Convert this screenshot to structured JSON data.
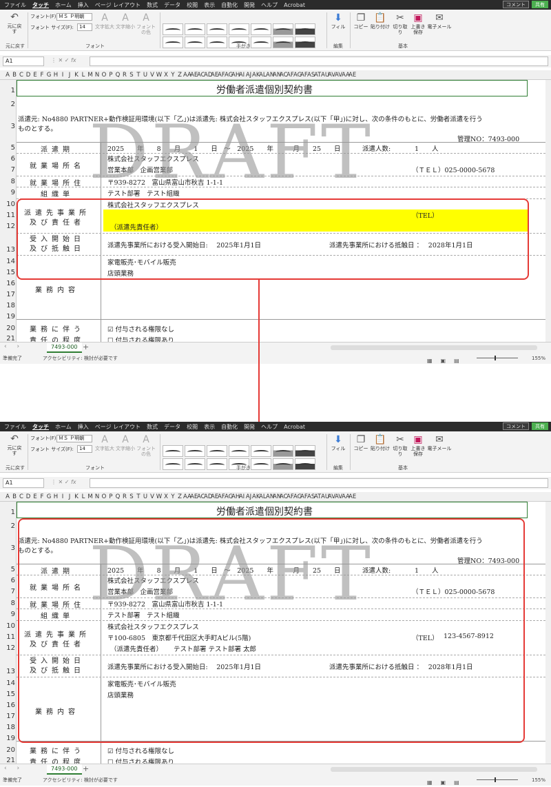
{
  "menu": {
    "items": [
      "ファイル",
      "タッチ",
      "ホーム",
      "挿入",
      "ページ レイアウト",
      "数式",
      "データ",
      "校閲",
      "表示",
      "自動化",
      "開発",
      "ヘルプ",
      "Acrobat"
    ],
    "active_index": 1,
    "comment": "コメント",
    "share": "共有"
  },
  "ribbon": {
    "undo": "元に戻す",
    "undo_group": "元に戻す",
    "font_label": "フォント(F):",
    "font_value": "ＭＳ Ｐ明朝",
    "size_label": "フォント サイズ(F):",
    "size_value": "14",
    "grow": "文字拡大",
    "shrink": "文字縮小",
    "font_color": "フォントの色",
    "font_group": "フォント",
    "ink_group": "手がき",
    "fill": "フィル",
    "edit_group": "編集",
    "copy": "コピー",
    "paste": "貼り付け",
    "cut": "切り取り",
    "save": "上書き保存",
    "email": "電子メール",
    "basic_group": "基本"
  },
  "formula": {
    "name_box": "A1",
    "fx": "fx"
  },
  "columns": [
    "A",
    "B",
    "C",
    "D",
    "E",
    "F",
    "G",
    "H",
    "I",
    "J",
    "K",
    "L",
    "M",
    "N",
    "O",
    "P",
    "Q",
    "R",
    "S",
    "T",
    "U",
    "V",
    "W",
    "X",
    "Y",
    "Z",
    "AA",
    "AE",
    "AC",
    "AD",
    "AE",
    "AF",
    "AG",
    "AH",
    "AI",
    "AJ",
    "AK",
    "AL",
    "AN",
    "AN",
    "AC",
    "AF",
    "AG",
    "AF",
    "AS",
    "AT",
    "AU",
    "AV",
    "AV",
    "AA",
    "AE"
  ],
  "sheet": {
    "title": "労働者派遣個別契約書",
    "intro1": "派遣元: No4880 PARTNER+動作検証用環境(以下「乙」)は派遣先: 株式会社スタッフエクスプレス(以下「甲」)に対し、次の条件のもとに、労働者派遣を行う",
    "intro2": "ものとする。",
    "mgmt_no": "管理NO：7493-000",
    "period_label": "派遣期",
    "period_value": "2025　　年　　8　　月　　1　　日　～　2025　　年　　　月　　25　　日",
    "headcount_label": "派遣人数:",
    "headcount_value": "1　　人",
    "workplace_label": "就業場所名",
    "workplace1": "株式会社スタッフエクスプレス",
    "workplace2": "営業本部　企画営業部",
    "workplace_tel": "（ＴＥＬ）025-0000-5678",
    "address_label": "就業場所住",
    "address_value": "〒939-8272　富山県富山市秋吉 1-1-1",
    "org_label": "組織単",
    "org_value": "テスト部署　テスト組織",
    "dispatch_label1": "派遣先事業所",
    "dispatch_label2": "及び責任者",
    "dispatch_name": "株式会社スタッフエクスプレス",
    "tel_label": "（TEL）",
    "tel_value": "123-4567-8912",
    "dispatch_address": "〒100-6805　東京都千代田区大手町Aビル(5階)",
    "resp_label": "（派遣先責任者）",
    "resp_value": "テスト部署 テスト部署 太郎",
    "start_label1": "受入開始日",
    "start_label2": "及び抵触日",
    "start_value": "派遣先事業所における受入開始日:　 2025年1月1日",
    "conflict_value": "派遣先事業所における抵触日 ：　 2028年1月1日",
    "duty1": "家電販売･モバイル販売",
    "duty2": "店頭業務",
    "duty_label": "業務内容",
    "resp_deg_label1": "業務に伴う",
    "resp_deg_label2": "責任の程度",
    "check1": "☑ 付与される権限なし",
    "check2": "☐ 付与される権限あり"
  },
  "watermark": "DRAFT",
  "tab": "7493-000",
  "status": {
    "ready": "準備完了",
    "access": "アクセシビリティ: 検討が必要です",
    "zoom": "155%"
  },
  "annotation_color": "#e53935"
}
